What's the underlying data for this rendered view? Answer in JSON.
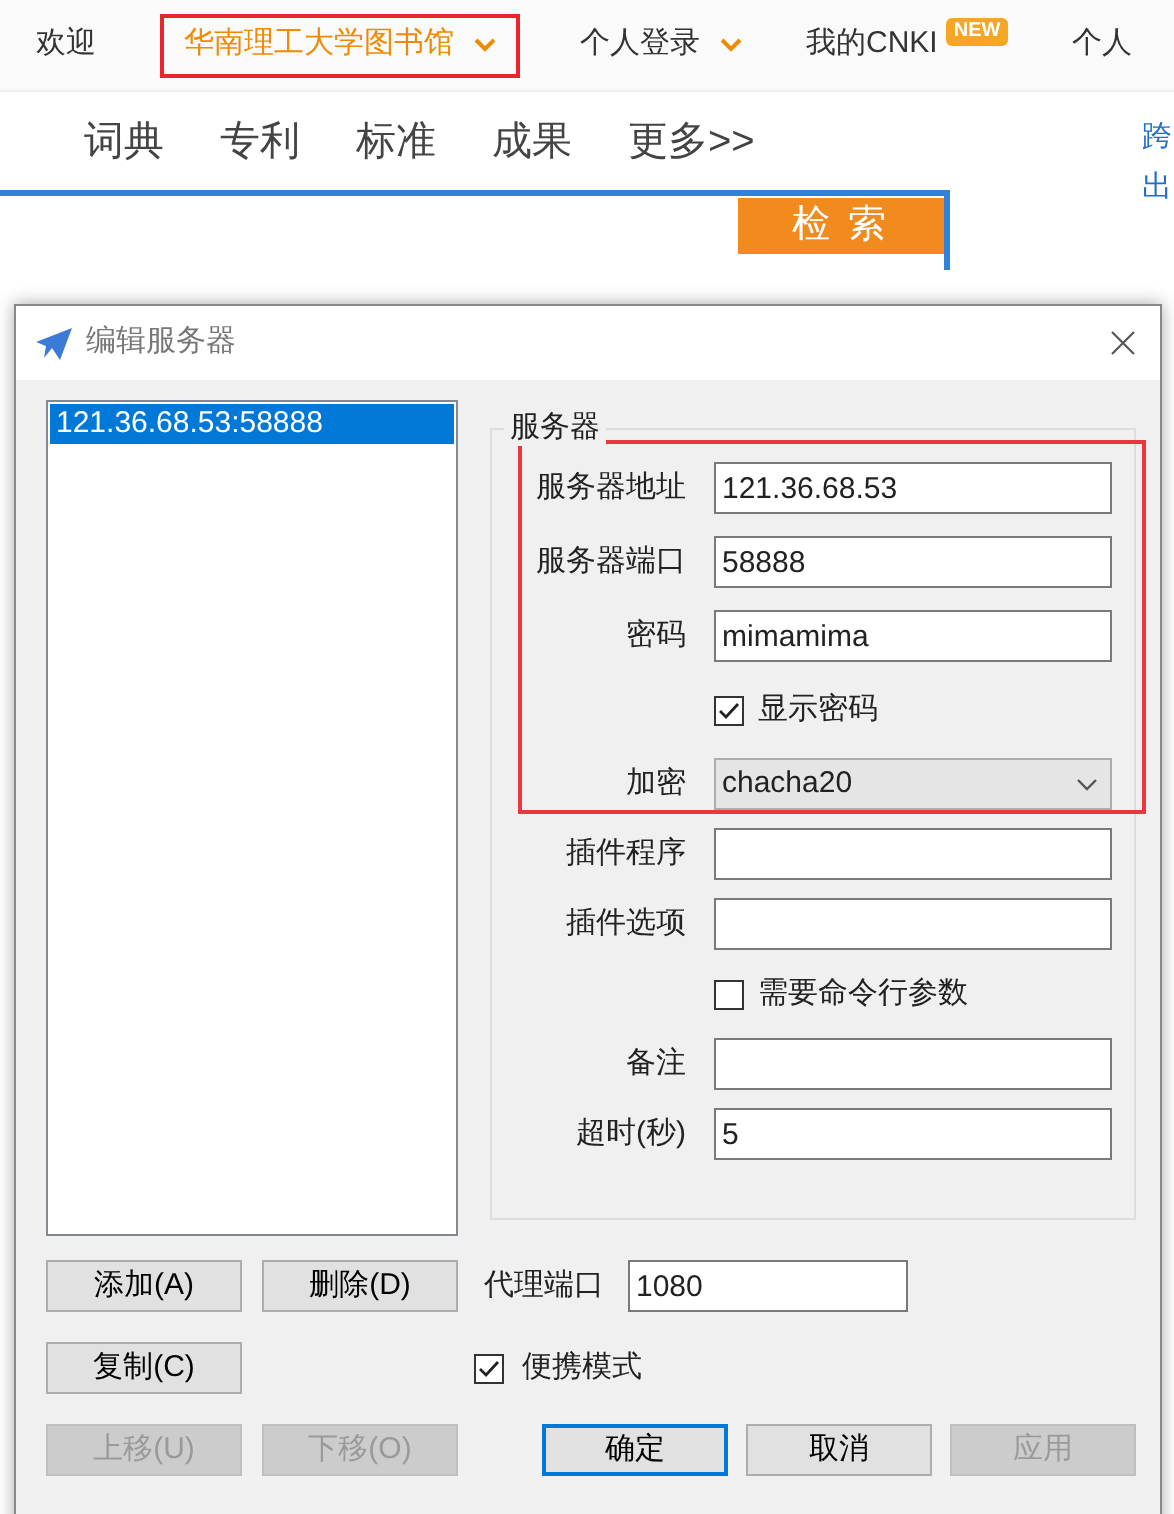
{
  "page": {
    "nav": [
      {
        "label": "欢迎",
        "kind": "text",
        "selected": false,
        "highlighted": false
      },
      {
        "label": "华南理工大学图书馆",
        "kind": "dropdown",
        "selected": true,
        "highlighted": true
      },
      {
        "label": "个人登录",
        "kind": "dropdown",
        "selected": false,
        "highlighted": false
      },
      {
        "label": "我的CNKI",
        "kind": "badge",
        "badge": "NEW",
        "selected": false,
        "highlighted": false
      },
      {
        "label": "个人",
        "kind": "text",
        "selected": false,
        "highlighted": false
      }
    ],
    "tabs": [
      "词典",
      "专利",
      "标准",
      "成果",
      "更多>>"
    ],
    "search_button": "检 索",
    "side_links": [
      "跨",
      "出"
    ]
  },
  "dialog": {
    "title": "编辑服务器",
    "servers": [
      {
        "label": "121.36.68.53:58888",
        "selected": true
      }
    ],
    "group_title": "服务器",
    "highlighted_fields": [
      {
        "kind": "text",
        "label": "服务器地址",
        "value": "121.36.68.53"
      },
      {
        "kind": "text",
        "label": "服务器端口",
        "value": "58888"
      },
      {
        "kind": "text",
        "label": "密码",
        "value": "mimamima"
      },
      {
        "kind": "checkbox",
        "label": "显示密码",
        "checked": true
      },
      {
        "kind": "select",
        "label": "加密",
        "value": "chacha20"
      }
    ],
    "other_fields": [
      {
        "kind": "text",
        "label": "插件程序"
      },
      {
        "kind": "text",
        "label": "插件选项"
      },
      {
        "kind": "checkbox",
        "label": "需要命令行参数",
        "checked": false
      },
      {
        "kind": "text",
        "label": "备注"
      },
      {
        "kind": "text",
        "label": "超时(秒)",
        "value": "5"
      }
    ],
    "list_buttons": [
      {
        "label": "添加(A)",
        "disabled": false
      },
      {
        "label": "删除(D)",
        "disabled": false
      },
      {
        "label": "复制(C)",
        "disabled": false
      },
      {
        "label": "上移(U)",
        "disabled": true
      },
      {
        "label": "下移(O)",
        "disabled": true
      }
    ],
    "proxy_port": {
      "label": "代理端口",
      "value": "1080"
    },
    "portable": {
      "label": "便携模式",
      "checked": true
    },
    "actions": [
      {
        "label": "确定",
        "default": true,
        "disabled": false
      },
      {
        "label": "取消",
        "default": false,
        "disabled": false
      },
      {
        "label": "应用",
        "default": false,
        "disabled": true
      }
    ]
  }
}
